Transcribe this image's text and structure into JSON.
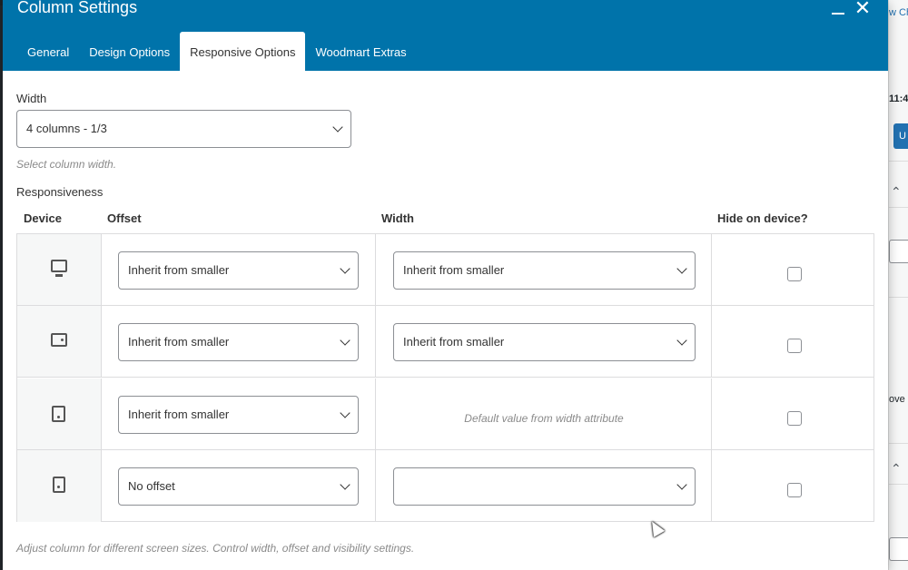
{
  "background": {
    "fragments": [
      "w Ch",
      "11:4",
      "U",
      "ove"
    ]
  },
  "modal": {
    "title": "Column Settings",
    "tabs": [
      {
        "label": "General"
      },
      {
        "label": "Design Options"
      },
      {
        "label": "Responsive Options",
        "active": true
      },
      {
        "label": "Woodmart Extras"
      }
    ],
    "width": {
      "label": "Width",
      "value": "4 columns - 1/3",
      "hint": "Select column width."
    },
    "responsiveness": {
      "label": "Responsiveness",
      "headers": {
        "device": "Device",
        "offset": "Offset",
        "width": "Width",
        "hide": "Hide on device?"
      },
      "rows": [
        {
          "device_icon": "desktop-icon",
          "offset": "Inherit from smaller",
          "width": "Inherit from smaller",
          "hide": false
        },
        {
          "device_icon": "tablet-landscape-icon",
          "offset": "Inherit from smaller",
          "width": "Inherit from smaller",
          "hide": false
        },
        {
          "device_icon": "tablet-portrait-icon",
          "offset": "Inherit from smaller",
          "width_hint": "Default value from width attribute",
          "hide": false
        },
        {
          "device_icon": "phone-icon",
          "offset": "No offset",
          "width": "",
          "hide": false
        }
      ],
      "footer_hint": "Adjust column for different screen sizes. Control width, offset and visibility settings."
    }
  },
  "colors": {
    "header": "#0073aa",
    "text": "#333333",
    "hint": "#8a8a8a"
  }
}
